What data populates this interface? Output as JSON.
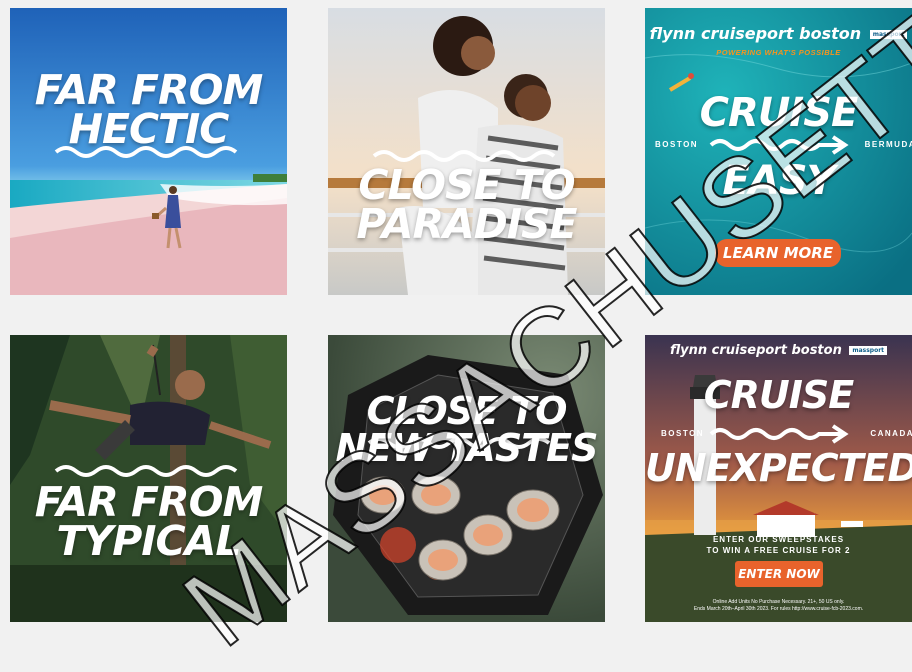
{
  "tiles": [
    {
      "headline_lines": [
        "FAR FROM",
        "HECTIC"
      ],
      "scene": "beach-with-walking-woman"
    },
    {
      "headline_lines": [
        "CLOSE TO",
        "PARADISE"
      ],
      "scene": "couple-piggyback-on-deck"
    },
    {
      "brand": "flynn cruiseport boston",
      "brand_badge": "massport",
      "tagline": "POWERING WHAT'S POSSIBLE",
      "headline_top": "CRUISE",
      "headline_bottom": "EASY",
      "route_left": "BOSTON",
      "route_right": "BERMUDA",
      "cta": "LEARN MORE",
      "scene": "aerial-ocean-snorkeler"
    },
    {
      "headline_lines": [
        "FAR FROM",
        "TYPICAL"
      ],
      "scene": "man-on-zipline-in-forest"
    },
    {
      "headline_lines": [
        "CLOSE TO",
        "NEW TASTES"
      ],
      "scene": "clams-on-grill"
    },
    {
      "brand": "flynn cruiseport boston",
      "brand_badge": "massport",
      "headline_top": "CRUISE",
      "headline_bottom": "UNEXPECTED",
      "route_left": "BOSTON",
      "route_right": "CANADA",
      "promo_line1": "ENTER OUR SWEEPSTAKES",
      "promo_line2": "TO WIN A FREE CRUISE FOR 2",
      "cta": "ENTER NOW",
      "fine_print_line1": "Online Add Units No Purchase Necessary. 21+, 50 US only.",
      "fine_print_line2": "Ends March 20th–April 30th 2023. For rules http://www.cruise-fcb-2023.com.",
      "scene": "lighthouse-at-sunset"
    }
  ],
  "watermark": "MASSACHUSETTS",
  "colors": {
    "page_bg": "#f1f1f1",
    "cta": "#e8632c",
    "tagline": "#f7941d",
    "ocean": "#0e8aa0"
  }
}
